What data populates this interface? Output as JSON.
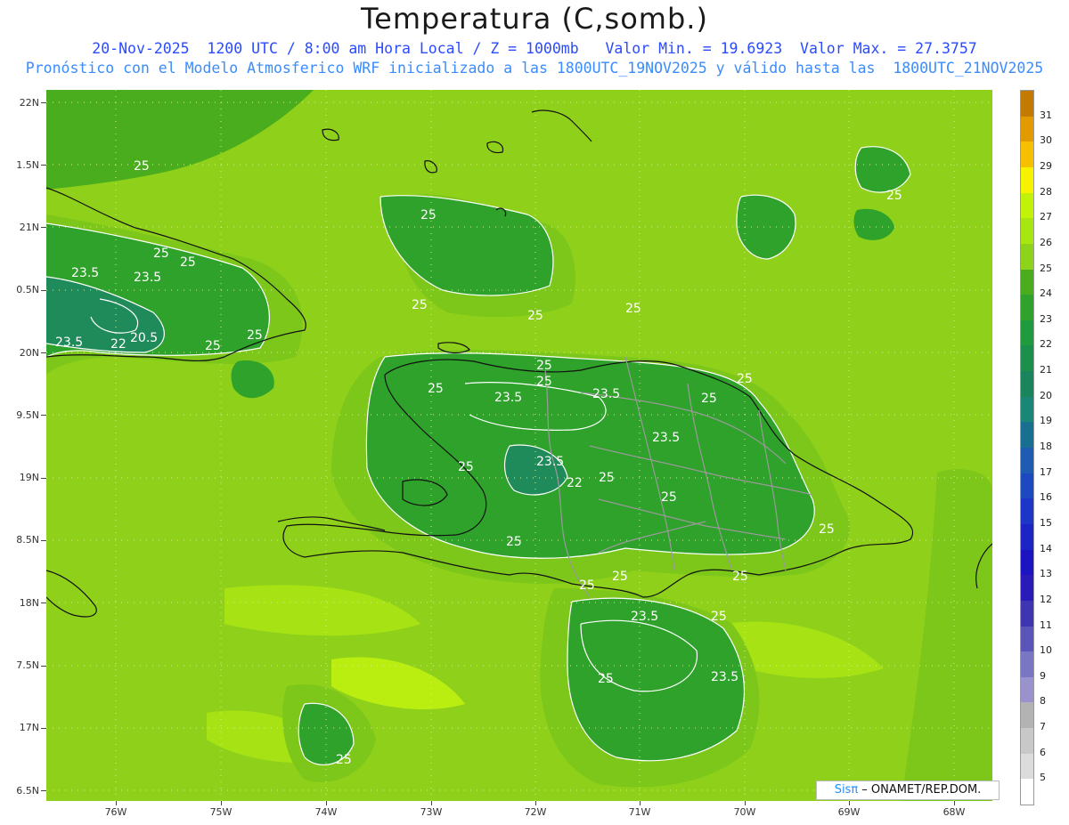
{
  "header": {
    "title": "Temperatura (C,somb.)",
    "line1": "20-Nov-2025  1200 UTC / 8:00 am Hora Local / Z = 1000mb   Valor Min. = 19.6923  Valor Max. = 27.3757",
    "line2": "Pronóstico con el Modelo Atmosferico WRF inicializado a las 1800UTC_19NOV2025 y válido hasta las  1800UTC_21NOV2025"
  },
  "axes": {
    "lat_labels": [
      "22N",
      "1.5N",
      "21N",
      "0.5N",
      "20N",
      "9.5N",
      "19N",
      "8.5N",
      "18N",
      "7.5N",
      "17N",
      "6.5N"
    ],
    "lon_labels": [
      "76W",
      "75W",
      "74W",
      "73W",
      "72W",
      "71W",
      "70W",
      "69W",
      "68W"
    ]
  },
  "colorbar": {
    "labels": [
      "31",
      "30",
      "29",
      "28",
      "27",
      "26",
      "25",
      "24",
      "23",
      "22",
      "21",
      "20",
      "19",
      "18",
      "17",
      "16",
      "15",
      "14",
      "13",
      "12",
      "11",
      "10",
      "9",
      "8",
      "7",
      "6",
      "5"
    ],
    "colors": [
      "#c27a00",
      "#e39a00",
      "#f6bf00",
      "#f7f200",
      "#c2f20a",
      "#a8e612",
      "#8dd319",
      "#4aad1e",
      "#2ea22a",
      "#1f9a3c",
      "#1c8f4c",
      "#1a855c",
      "#1a8676",
      "#196f8f",
      "#1d5cb0",
      "#1d49c0",
      "#1d36c8",
      "#1d24c4",
      "#1b14c0",
      "#2a1ab8",
      "#3f35b0",
      "#5a55b8",
      "#7a76c4",
      "#9a92cc",
      "#b3b3b3",
      "#c8c8c8",
      "#dcdcdc",
      "#ffffff"
    ]
  },
  "contour_labels": [
    "25",
    "25",
    "23.5",
    "23.5",
    "25",
    "23.5",
    "22",
    "20.5",
    "25",
    "25",
    "25",
    "25",
    "25",
    "25",
    "25",
    "25",
    "23.5",
    "25",
    "25",
    "23.5",
    "25",
    "23.5",
    "25",
    "23.5",
    "22",
    "25",
    "25",
    "25",
    "25",
    "25",
    "25",
    "25",
    "23.5",
    "25",
    "25",
    "23.5",
    "25",
    "25"
  ],
  "credit": {
    "brand": "Sisπ",
    "text": " – ONAMET/REP.DOM."
  }
}
